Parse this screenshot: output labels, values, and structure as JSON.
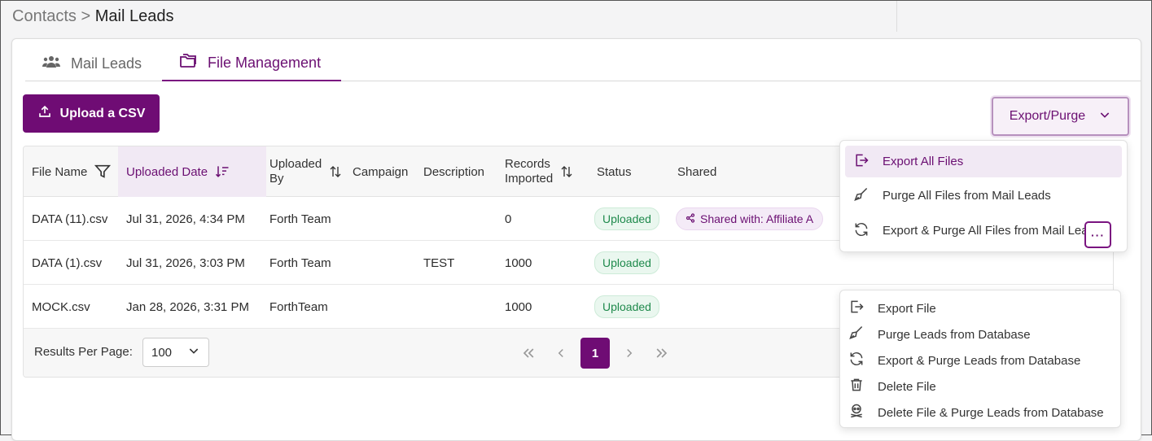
{
  "breadcrumb": {
    "parent": "Contacts",
    "separator": ">",
    "current": "Mail Leads"
  },
  "tabs": [
    {
      "label": "Mail Leads",
      "icon": "users-icon",
      "active": false
    },
    {
      "label": "File Management",
      "icon": "folder-icon",
      "active": true
    }
  ],
  "toolbar": {
    "upload_label": "Upload a CSV",
    "export_label": "Export/Purge"
  },
  "table": {
    "headers": {
      "file_name": "File Name",
      "uploaded_date": "Uploaded Date",
      "uploaded_by_1": "Uploaded",
      "uploaded_by_2": "By",
      "campaign": "Campaign",
      "description": "Description",
      "records_1": "Records",
      "records_2": "Imported",
      "status": "Status",
      "shared": "Shared"
    },
    "rows": [
      {
        "file_name": "DATA (11).csv",
        "uploaded_date": "Jul 31, 2026, 4:34 PM",
        "uploaded_by": "Forth Team",
        "campaign": "",
        "description": "",
        "records": "0",
        "status": "Uploaded",
        "shared": "Shared with: Affiliate A"
      },
      {
        "file_name": "DATA (1).csv",
        "uploaded_date": "Jul 31, 2026, 3:03 PM",
        "uploaded_by": "Forth Team",
        "campaign": "",
        "description": "TEST",
        "records": "1000",
        "status": "Uploaded",
        "shared": ""
      },
      {
        "file_name": "MOCK.csv",
        "uploaded_date": "Jan 28, 2026, 3:31 PM",
        "uploaded_by": "ForthTeam",
        "campaign": "",
        "description": "",
        "records": "1000",
        "status": "Uploaded",
        "shared": ""
      }
    ]
  },
  "pagination": {
    "results_label": "Results Per Page:",
    "per_page": "100",
    "current_page": "1"
  },
  "export_menu": {
    "items": [
      {
        "label": "Export All Files",
        "icon": "export-icon"
      },
      {
        "label": "Purge All Files from Mail Leads",
        "icon": "broom-icon"
      },
      {
        "label": "Export & Purge All Files from Mail Leads",
        "icon": "refresh-icon"
      }
    ]
  },
  "row_menu": {
    "dots": "···",
    "items": [
      {
        "label": "Export File",
        "icon": "export-icon"
      },
      {
        "label": "Purge Leads from Database",
        "icon": "broom-icon"
      },
      {
        "label": "Export & Purge Leads from Database",
        "icon": "refresh-icon"
      },
      {
        "label": "Delete File",
        "icon": "trash-icon"
      },
      {
        "label": "Delete File & Purge Leads from Database",
        "icon": "skull-icon"
      }
    ]
  },
  "colors": {
    "brand": "#6f0c74",
    "status_green": "#1f8a4c",
    "highlight": "#f1e9f4"
  }
}
